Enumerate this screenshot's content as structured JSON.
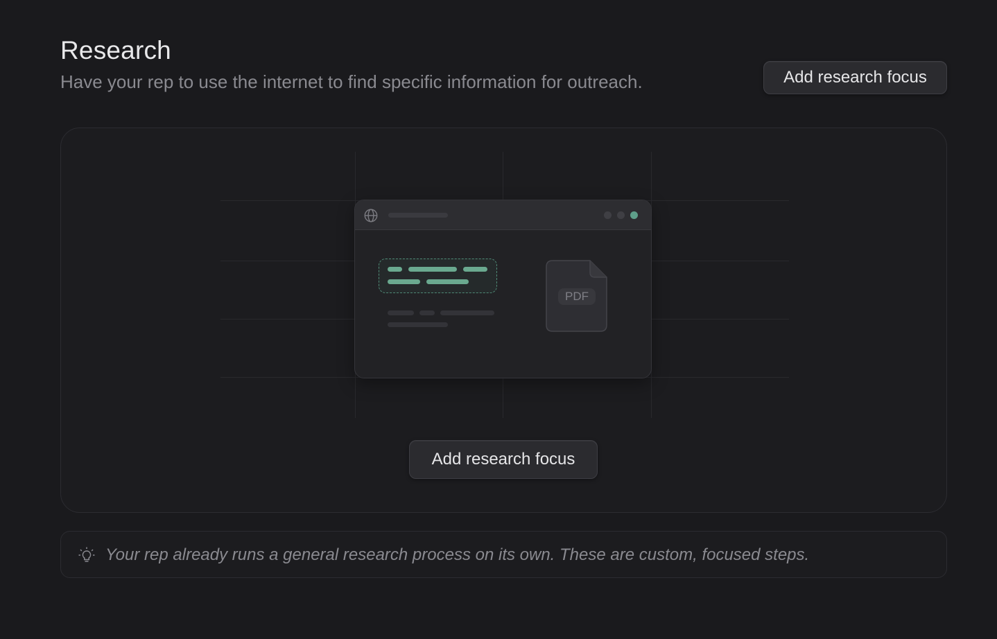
{
  "header": {
    "title": "Research",
    "subtitle": "Have your rep to use the internet to find specific information for outreach.",
    "add_button_label": "Add research focus"
  },
  "empty_state": {
    "illustration": {
      "browser_icon": "globe-icon",
      "file_label": "PDF"
    },
    "add_button_label": "Add research focus"
  },
  "tip": {
    "icon": "lightbulb-icon",
    "text": "Your rep already runs a general research process on its own. These are custom, focused steps."
  },
  "colors": {
    "background": "#1a1a1d",
    "accent": "#6aa98f"
  }
}
